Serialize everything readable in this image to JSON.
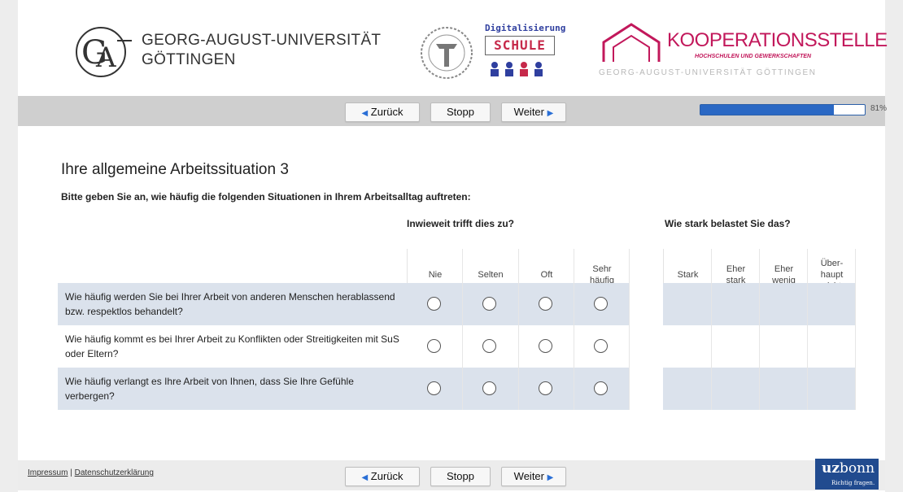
{
  "header": {
    "university_line1": "GEORG-AUGUST-UNIVERSITÄT",
    "university_line2": "GÖTTINGEN",
    "partner_top": "Digitalisierung",
    "partner_schule": "SCHULE",
    "kooperation_name": "KOOPERATIONSSTELLE",
    "kooperation_sub": "HOCHSCHULEN UND GEWERKSCHAFTEN",
    "kooperation_uni": "GEORG-AUGUST-UNIVERSITÄT GÖTTINGEN"
  },
  "nav": {
    "back_label": "Zurück",
    "stop_label": "Stopp",
    "next_label": "Weiter",
    "progress_percent": 81,
    "progress_text": "81%"
  },
  "survey": {
    "title": "Ihre allgemeine Arbeitssituation 3",
    "instruction": "Bitte geben Sie an, wie häufig die folgenden Situationen in Ihrem Arbeitsalltag auftreten:",
    "group1": "Inwieweit trifft dies zu?",
    "group2": "Wie stark belastet Sie das?",
    "columns1": [
      "Nie",
      "Selten",
      "Oft",
      "Sehr\nhäufig"
    ],
    "columns2": [
      "Stark",
      "Eher\nstark",
      "Eher\nwenig",
      "Über-\nhaupt\nnicht"
    ],
    "rows": [
      {
        "question": "Wie häufig werden Sie bei Ihrer Arbeit von anderen Menschen herablassend bzw. respektlos behandelt?"
      },
      {
        "question": "Wie häufig kommt es bei Ihrer Arbeit zu Konflikten oder Streitigkeiten mit SuS oder Eltern?"
      },
      {
        "question": "Wie häufig verlangt es Ihre Arbeit von Ihnen, dass Sie Ihre Gefühle verbergen?"
      }
    ]
  },
  "footer": {
    "impressum": "Impressum",
    "separator": "|",
    "datenschutz": "Datenschutzerklärung",
    "uz_brand_bold": "uz",
    "uz_brand_rest": "bonn",
    "uz_tagline": "Richtig fragen."
  },
  "colors": {
    "accent": "#2a68c4",
    "row_shade": "#dbe2ec",
    "navbar": "#cfcfcf",
    "kooperation": "#c2185b"
  }
}
